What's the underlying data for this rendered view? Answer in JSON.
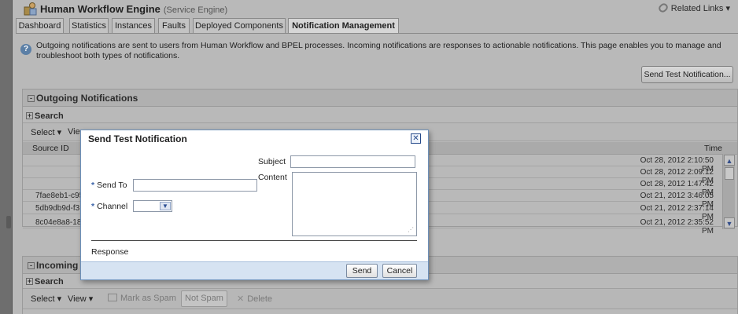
{
  "header": {
    "title": "Human Workflow Engine",
    "subtitle": "(Service Engine)",
    "related_links": "Related Links ▾"
  },
  "tabs": [
    {
      "label": "Dashboard"
    },
    {
      "label": "Statistics"
    },
    {
      "label": "Instances"
    },
    {
      "label": "Faults"
    },
    {
      "label": "Deployed Components"
    },
    {
      "label": "Notification Management"
    }
  ],
  "info": {
    "text": "Outgoing notifications are sent to users from Human Workflow and BPEL processes. Incoming notifications are responses to actionable notifications. This page enables you to manage and troubleshoot both types of notifications."
  },
  "send_test_button": "Send Test Notification...",
  "outgoing": {
    "title": "Outgoing Notifications",
    "search": "Search",
    "toolbar": {
      "select": "Select ▾",
      "view": "View"
    },
    "col_source": "Source ID",
    "col_time": "Time",
    "rows": [
      {
        "source": "",
        "time": "Oct 28, 2012 2:10:50 PM"
      },
      {
        "source": "",
        "time": "Oct 28, 2012 2:09:12 PM"
      },
      {
        "source": "",
        "time": "Oct 28, 2012 1:47:42 PM"
      },
      {
        "source": "7fae8eb1-c95",
        "time": "Oct 21, 2012 3:46:05 PM"
      },
      {
        "source": "5db9db9d-f3",
        "time": "Oct 21, 2012 2:37:14 PM"
      },
      {
        "source": "8c04e8a8-18",
        "time": "Oct 21, 2012 2:35:52 PM"
      }
    ]
  },
  "incoming": {
    "title": "Incoming",
    "search": "Search",
    "toolbar": {
      "select": "Select ▾",
      "view": "View ▾",
      "mark_spam": "Mark as Spam",
      "not_spam": "Not Spam",
      "delete": "Delete"
    }
  },
  "dialog": {
    "title": "Send Test Notification",
    "subject_label": "Subject",
    "content_label": "Content",
    "send_to_label": "Send To",
    "channel_label": "Channel",
    "required_mark": "*",
    "response_label": "Response",
    "send_button": "Send",
    "cancel_button": "Cancel"
  },
  "colors": {
    "accent": "#3a62a8",
    "dialog_border": "#6c8fb8",
    "footer_bg": "#d6e3f2"
  }
}
